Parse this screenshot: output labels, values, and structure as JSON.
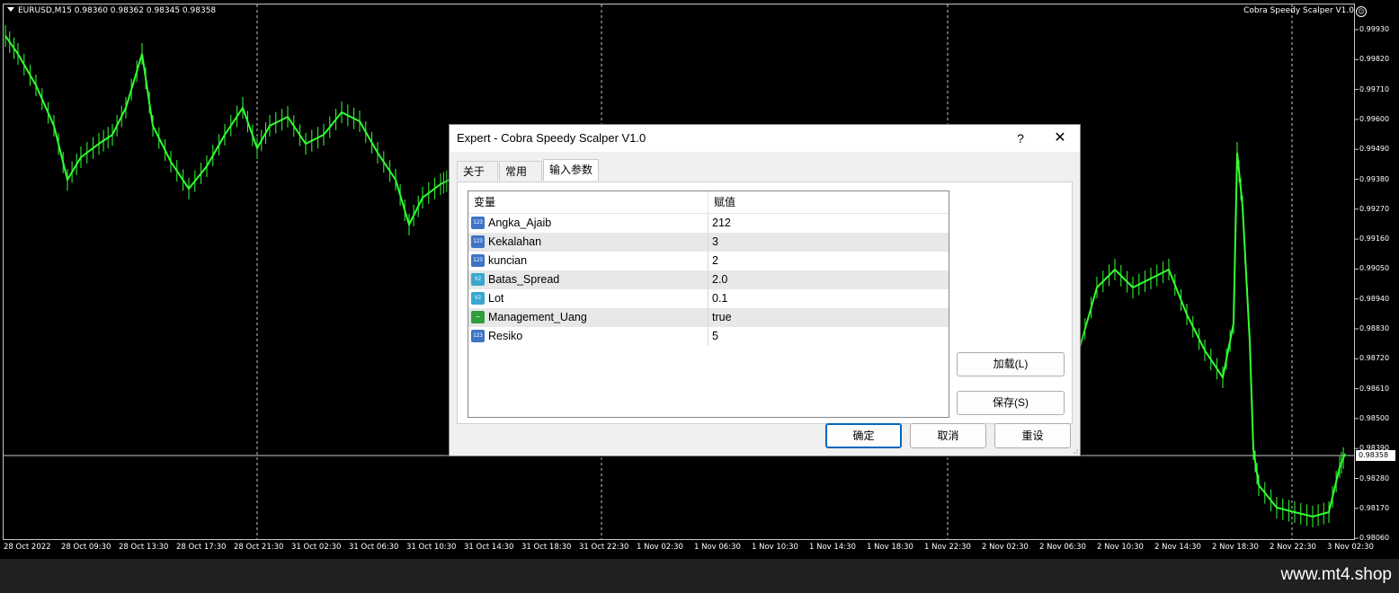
{
  "chart": {
    "symbol_info": "EURUSD,M15  0.98360 0.98362 0.98345 0.98358",
    "ea_name": "Cobra Speedy Scalper V1.0",
    "current_price": "0.98358",
    "price_labels": [
      "0.99930",
      "0.99820",
      "0.99710",
      "0.99600",
      "0.99490",
      "0.99380",
      "0.99270",
      "0.99160",
      "0.99050",
      "0.98940",
      "0.98830",
      "0.98720",
      "0.98610",
      "0.98500",
      "0.98390",
      "0.98280",
      "0.98170",
      "0.98060"
    ],
    "time_labels": [
      "28 Oct 2022",
      "28 Oct 09:30",
      "28 Oct 13:30",
      "28 Oct 17:30",
      "28 Oct 21:30",
      "31 Oct 02:30",
      "31 Oct 06:30",
      "31 Oct 10:30",
      "31 Oct 14:30",
      "31 Oct 18:30",
      "31 Oct 22:30",
      "1 Nov 02:30",
      "1 Nov 06:30",
      "1 Nov 10:30",
      "1 Nov 14:30",
      "1 Nov 18:30",
      "1 Nov 22:30",
      "2 Nov 02:30",
      "2 Nov 06:30",
      "2 Nov 10:30",
      "2 Nov 14:30",
      "2 Nov 18:30",
      "2 Nov 22:30",
      "3 Nov 02:30"
    ],
    "candle_color": "#33ff33",
    "background_color": "#000000"
  },
  "footer": {
    "watermark": "www.mt4.shop"
  },
  "dialog": {
    "title": "Expert - Cobra Speedy Scalper V1.0",
    "help_label": "?",
    "close_label": "✕",
    "tabs": [
      {
        "label": "关于",
        "active": false
      },
      {
        "label": "常用",
        "active": false
      },
      {
        "label": "输入参数",
        "active": true
      }
    ],
    "grid_headers": {
      "variable": "变量",
      "value": "赋值"
    },
    "params": [
      {
        "name": "Angka_Ajaib",
        "value": "212",
        "type": "int",
        "type_text": "123"
      },
      {
        "name": "Kekalahan",
        "value": "3",
        "type": "int",
        "type_text": "123"
      },
      {
        "name": "kuncian",
        "value": "2",
        "type": "int",
        "type_text": "123"
      },
      {
        "name": "Batas_Spread",
        "value": "2.0",
        "type": "double",
        "type_text": "V2"
      },
      {
        "name": "Lot",
        "value": "0.1",
        "type": "double",
        "type_text": "V2"
      },
      {
        "name": "Management_Uang",
        "value": "true",
        "type": "bool",
        "type_text": "~"
      },
      {
        "name": "Resiko",
        "value": "5",
        "type": "int",
        "type_text": "123"
      }
    ],
    "load_label": "加载(L)",
    "save_label": "保存(S)",
    "ok_label": "确定",
    "cancel_label": "取消",
    "reset_label": "重设"
  }
}
